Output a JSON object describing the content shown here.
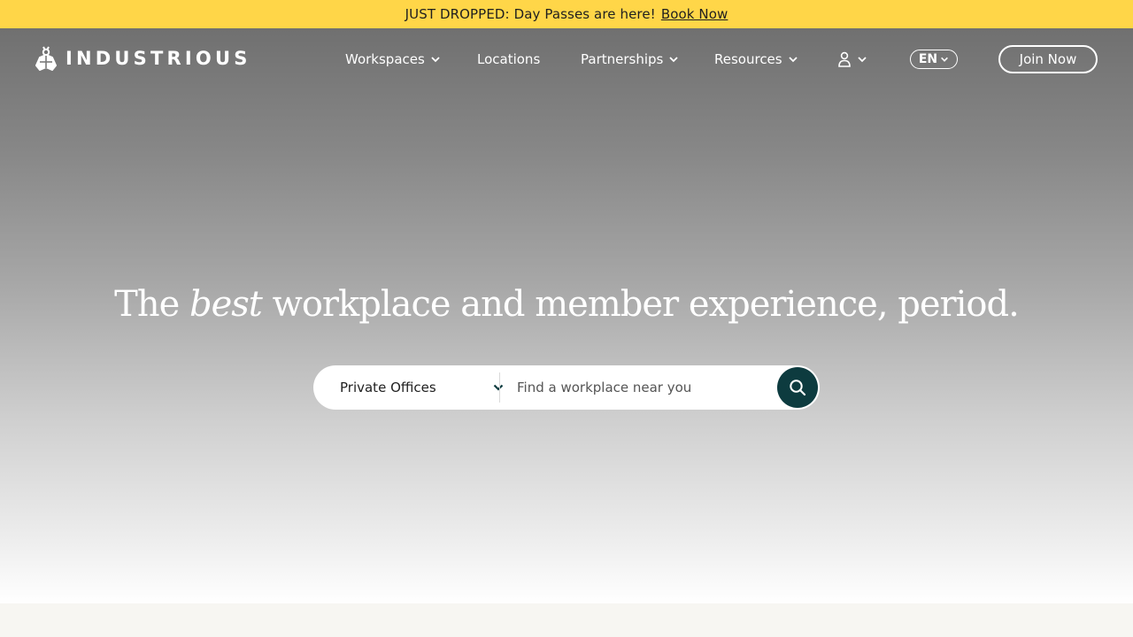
{
  "announcement": {
    "message": "JUST DROPPED: Day Passes are here!",
    "link": "Book Now"
  },
  "brand": {
    "name": "INDUSTRIOUS",
    "logo_icon": "bee-icon"
  },
  "nav": {
    "items": [
      {
        "label": "Workspaces",
        "has_dropdown": true
      },
      {
        "label": "Locations",
        "has_dropdown": false
      },
      {
        "label": "Partnerships",
        "has_dropdown": true
      },
      {
        "label": "Resources",
        "has_dropdown": true
      }
    ],
    "account_icon": "user-icon",
    "language": "EN",
    "cta": "Join Now"
  },
  "hero": {
    "headline_before": "The",
    "headline_emphasis": "best",
    "headline_after": "workplace and member experience, period."
  },
  "search": {
    "workspace_type": "Private Offices",
    "placeholder": "Find a workplace near you",
    "button_icon": "search-icon"
  },
  "colors": {
    "announcement_bg": "#FFD648",
    "search_button_bg": "#0D3B3F",
    "footer_bg": "#F7F6F2"
  }
}
